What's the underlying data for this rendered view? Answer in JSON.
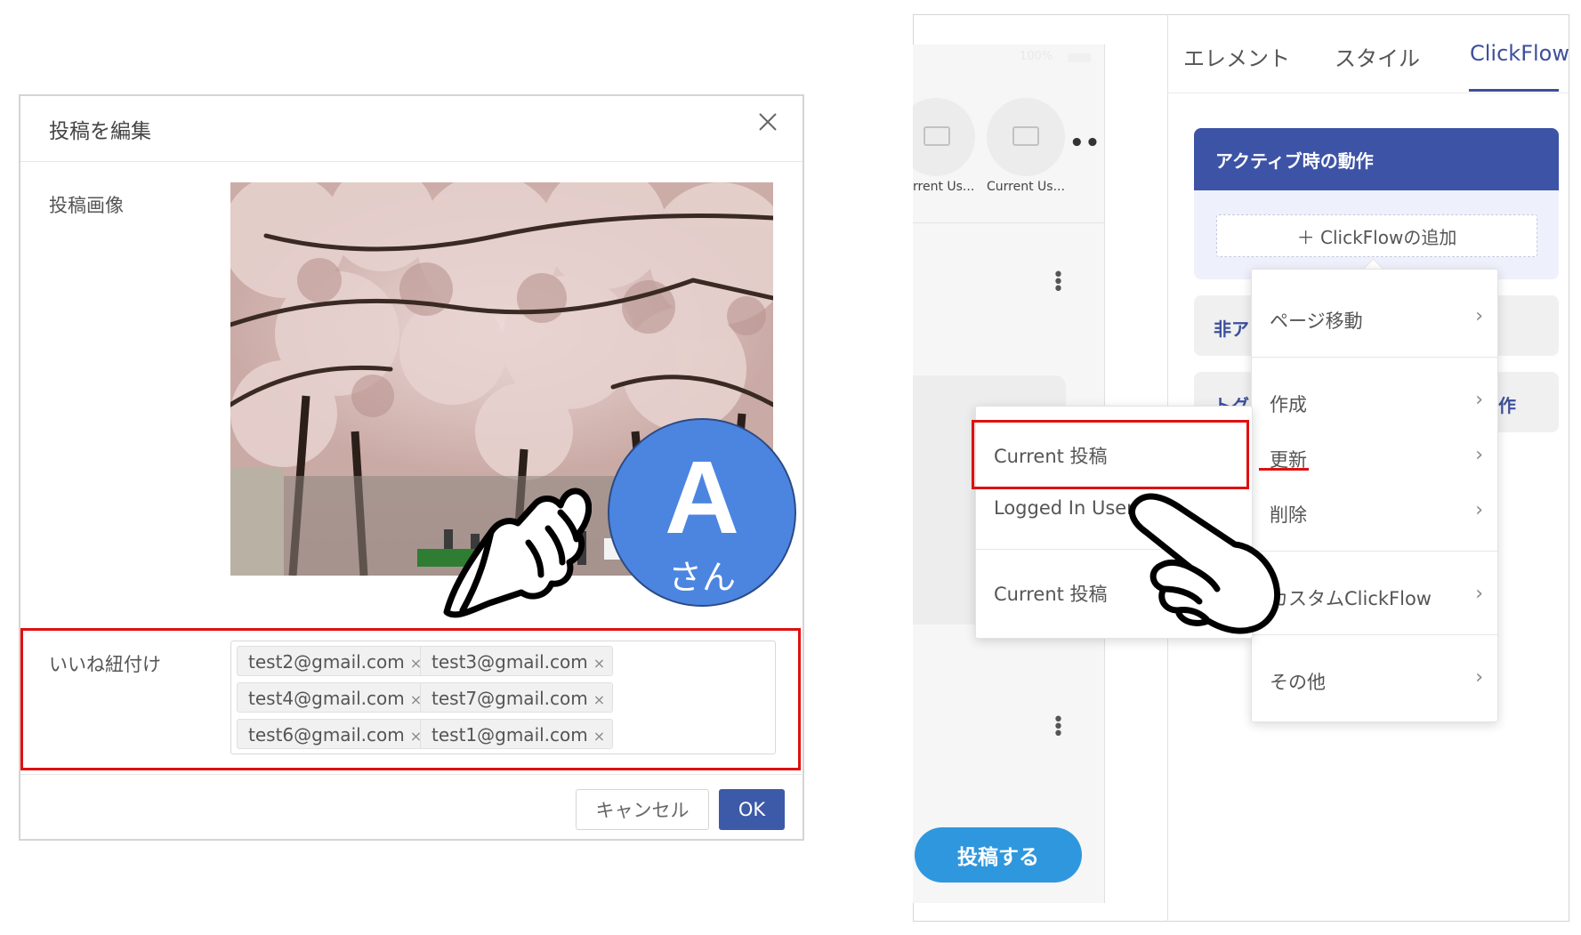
{
  "dialog": {
    "title": "投稿を編集",
    "close_icon": "close-icon",
    "image_label": "投稿画像",
    "likes_label": "いいね紐付け",
    "likes_tags": [
      "test2@gmail.com",
      "test3@gmail.com",
      "test4@gmail.com",
      "test7@gmail.com",
      "test6@gmail.com",
      "test1@gmail.com"
    ],
    "tag_remove": "×",
    "cancel_label": "キャンセル",
    "ok_label": "OK"
  },
  "avatar": {
    "letter": "A",
    "suffix": "さん",
    "color": "#4c85e0"
  },
  "preview": {
    "status": "100%",
    "items": [
      {
        "label": "rrent Us..."
      },
      {
        "label": "Current Us..."
      }
    ],
    "more": "•••",
    "post_button": "投稿する",
    "post_button_color": "#2f97de"
  },
  "tabs": {
    "element": "エレメント",
    "style": "スタイル",
    "clickflow": "ClickFlow",
    "active_color": "#3d4f9c"
  },
  "panel": {
    "active_header": "アクティブ時の動作",
    "add_clickflow": "＋ ClickFlowの追加",
    "inactive_partial": "非ア",
    "toggle_partial": "トグ",
    "toggle_suffix": "作",
    "header_color": "#3d53a6"
  },
  "menu": {
    "items": [
      "ページ移動",
      "作成",
      "更新",
      "削除",
      "カスタムClickFlow",
      "その他"
    ],
    "chevron": "›"
  },
  "submenu": {
    "items": [
      "Current 投稿",
      "Logged In User",
      "Current 投稿"
    ]
  },
  "highlight_color": "#e01010"
}
